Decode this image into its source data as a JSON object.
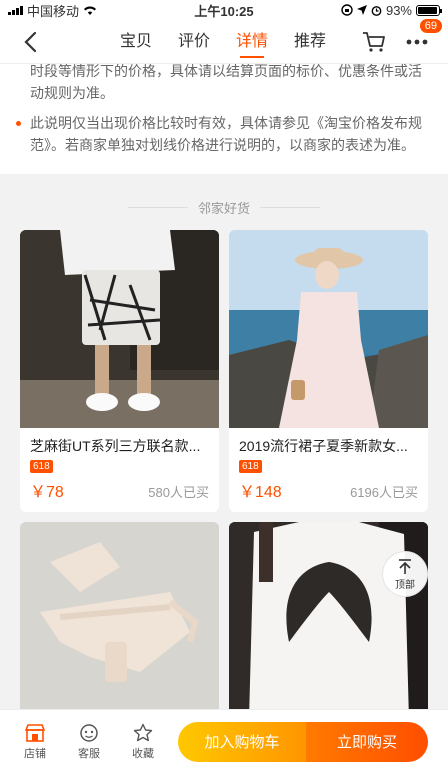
{
  "status": {
    "carrier": "中国移动",
    "time": "上午10:25",
    "battery": "93%"
  },
  "nav": {
    "tabs": [
      {
        "label": "宝贝",
        "active": false
      },
      {
        "label": "评价",
        "active": false
      },
      {
        "label": "详情",
        "active": true
      },
      {
        "label": "推荐",
        "active": false
      }
    ],
    "more_badge": "69"
  },
  "notes": {
    "cut_text": "时段等情形下的价格，具体请以结算页面的标价、优惠条件或活动规则为准。",
    "items": [
      "此说明仅当出现价格比较时有效，具体请参见《淘宝价格发布规范》。若商家单独对划线价格进行说明的，以商家的表述为准。"
    ]
  },
  "neighbor": {
    "title": "邻家好货",
    "products": [
      {
        "title": "芝麻街UT系列三方联名款...",
        "tag": "618",
        "price": "￥78",
        "sold": "580人已买"
      },
      {
        "title": "2019流行裙子夏季新款女...",
        "tag": "618",
        "price": "￥148",
        "sold": "6196人已买"
      },
      {
        "title": "",
        "tag": "",
        "price": "",
        "sold": ""
      },
      {
        "title": "",
        "tag": "",
        "price": "",
        "sold": ""
      }
    ]
  },
  "back_top_label": "顶部",
  "bottom": {
    "store": "店铺",
    "service": "客服",
    "favorite": "收藏",
    "add_cart": "加入购物车",
    "buy_now": "立即购买"
  },
  "colors": {
    "accent": "#ff5000",
    "cart_gradient": [
      "#ffc800",
      "#ff9500"
    ],
    "buy_gradient": [
      "#ff7a00",
      "#ff4e00"
    ]
  }
}
